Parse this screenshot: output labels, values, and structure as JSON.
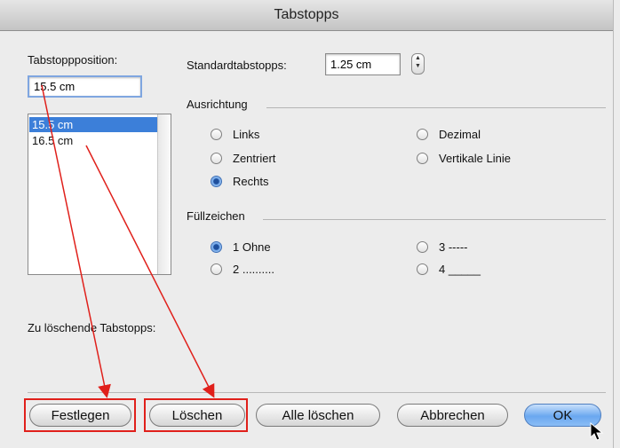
{
  "window": {
    "title": "Tabstopps"
  },
  "tab_position": {
    "label": "Tabstoppposition:",
    "value": "15.5 cm"
  },
  "tab_list": [
    "15.5 cm",
    "16.5 cm"
  ],
  "default_tabs": {
    "label": "Standardtabstopps:",
    "value": "1.25 cm"
  },
  "alignment": {
    "title": "Ausrichtung",
    "options": [
      "Links",
      "Zentriert",
      "Rechts",
      "Dezimal",
      "Vertikale Linie"
    ],
    "selected": "Rechts"
  },
  "leader": {
    "title": "Füllzeichen",
    "options": [
      "1 Ohne",
      "2 ..........",
      "3 -----",
      "4 _____"
    ],
    "selected": "1 Ohne"
  },
  "clear_label": "Zu löschende Tabstopps:",
  "buttons": {
    "set": "Festlegen",
    "clear": "Löschen",
    "clear_all": "Alle löschen",
    "cancel": "Abbrechen",
    "ok": "OK"
  },
  "colors": {
    "annotation": "#e0201b",
    "selection": "#3c7fd9"
  }
}
